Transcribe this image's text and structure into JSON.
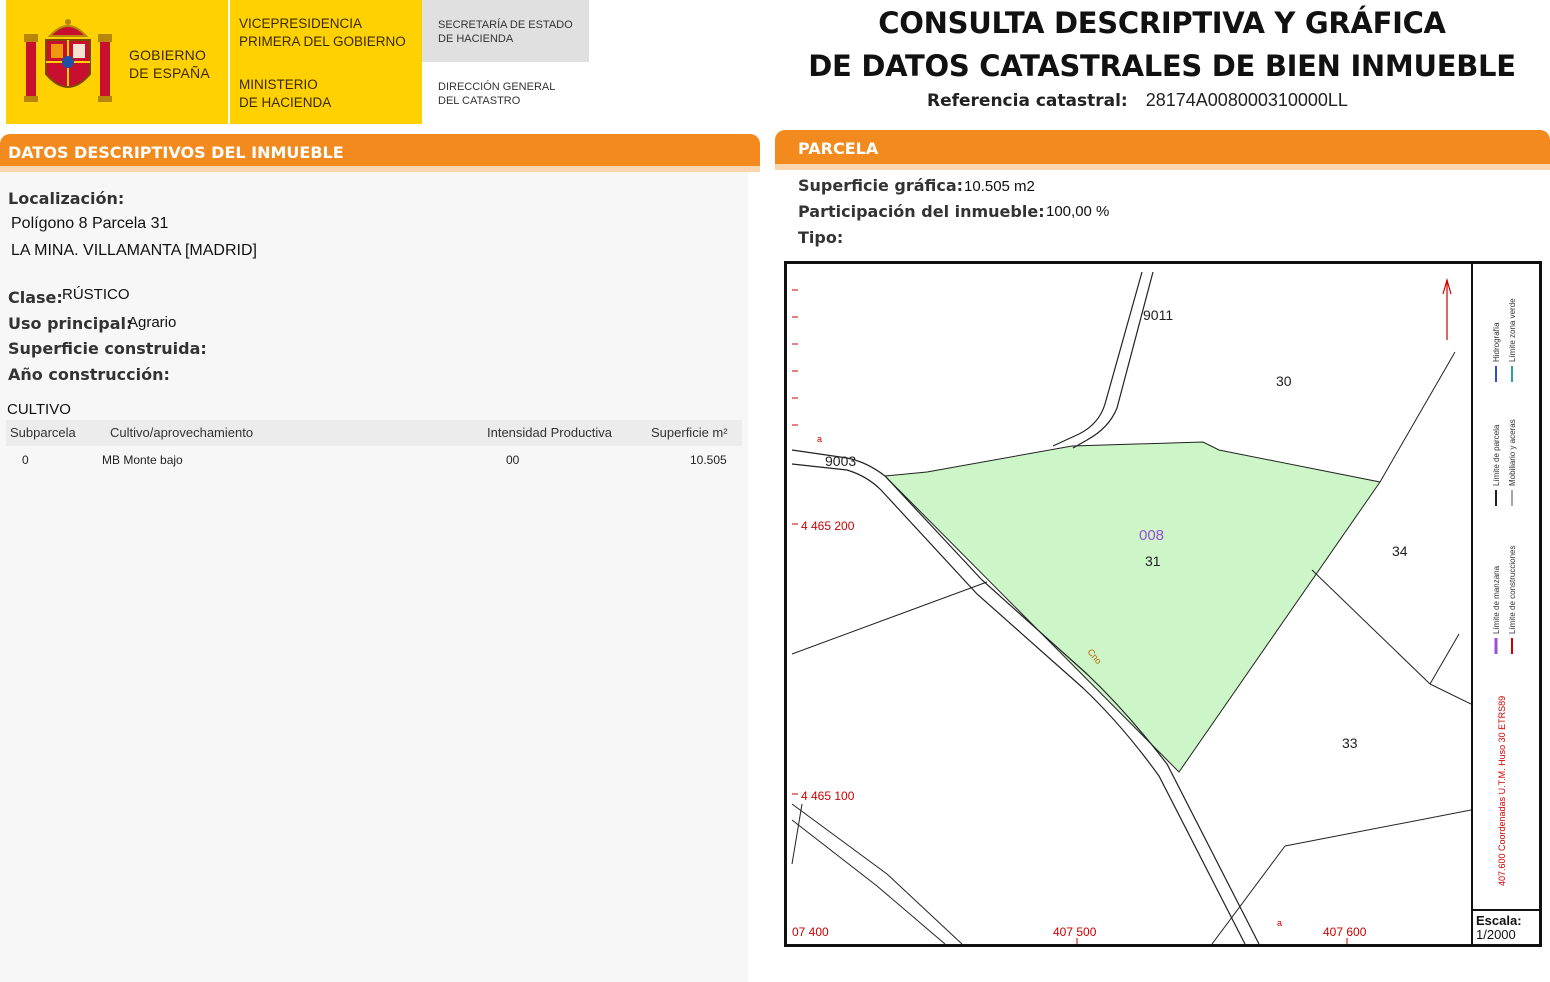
{
  "header": {
    "gov_name": [
      "GOBIERNO",
      "DE ESPAÑA"
    ],
    "vice": [
      "VICEPRESIDENCIA",
      "PRIMERA DEL GOBIERNO"
    ],
    "ministry": [
      "MINISTERIO",
      "DE HACIENDA"
    ],
    "secretaria": [
      "SECRETARÍA DE ESTADO",
      "DE HACIENDA"
    ],
    "direccion": [
      "DIRECCIÓN GENERAL",
      "DEL CATASTRO"
    ],
    "title_line1": "CONSULTA DESCRIPTIVA Y GRÁFICA",
    "title_line2": "DE DATOS CATASTRALES DE BIEN INMUEBLE",
    "ref_label": "Referencia catastral:",
    "ref_value": "28174A008000310000LL",
    "brand_yellow": "#ffd100",
    "accent_orange": "#f28a1d"
  },
  "datos": {
    "section_title": "DATOS DESCRIPTIVOS DEL INMUEBLE",
    "localizacion_label": "Localización:",
    "localizacion_line1": "Polígono 8 Parcela 31",
    "localizacion_line2": "LA MINA. VILLAMANTA [MADRID]",
    "clase_label": "Clase:",
    "clase_value": "RÚSTICO",
    "uso_label": "Uso principal:",
    "uso_value": "Agrario",
    "sup_construida_label": "Superficie construida:",
    "anio_label": "Año construcción:",
    "cultivo_title": "CULTIVO",
    "cultivo_headers": [
      "Subparcela",
      "Cultivo/aprovechamiento",
      "Intensidad Productiva",
      "Superficie m²"
    ],
    "cultivo_rows": [
      [
        "0",
        "MB Monte bajo",
        "00",
        "10.505"
      ]
    ]
  },
  "parcela": {
    "section_title": "PARCELA",
    "sup_grafica_label": "Superficie gráfica:",
    "sup_grafica_value": "10.505 m2",
    "participacion_label": "Participación del inmueble:",
    "participacion_value": "100,00 %",
    "tipo_label": "Tipo:",
    "map": {
      "parcel_fill": "#ccf5c8",
      "labels": {
        "road_9011": "9011",
        "road_9003": "9003",
        "poly": "008",
        "p31": "31",
        "p30": "30",
        "p34": "34",
        "p33": "33",
        "coord_y1": "4 465 200",
        "coord_y2": "4 465 100",
        "coord_x1": "07 400",
        "coord_x2": "407 500",
        "coord_x3": "407 600",
        "camino": "Cno",
        "mark_a": "a",
        "mark_b": "a"
      },
      "legend": [
        "Límite de manzana",
        "Límite de parcela",
        "Hidrografía",
        "Límite de construcciones",
        "Mobiliario y aceras",
        "Límite zona verde"
      ],
      "coords_caption": "407.600 Coordenadas U.T.M. Huso 30 ETRS89",
      "scale_label": "Escala:",
      "scale_value": "1/2000"
    }
  }
}
